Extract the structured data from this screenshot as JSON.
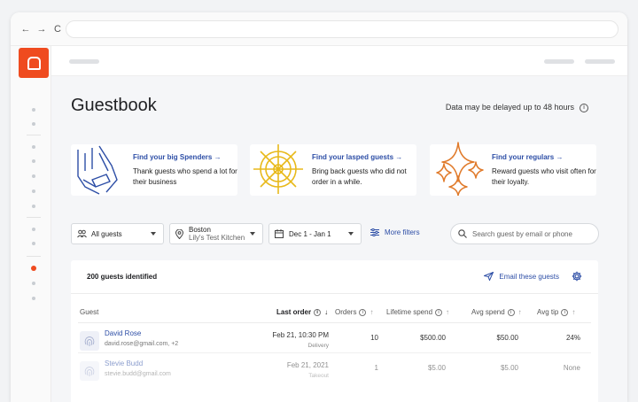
{
  "nav": {
    "back": "←",
    "forward": "→",
    "reload": "C"
  },
  "page": {
    "title": "Guestbook",
    "delay_note": "Data may be delayed up to 48 hours"
  },
  "cards": [
    {
      "title": "Find your big Spenders →",
      "desc": "Thank guests who spend a lot for their business"
    },
    {
      "title": "Find your lasped guests →",
      "desc": "Bring back guests who did not order in a while."
    },
    {
      "title": "Find your regulars →",
      "desc": "Reward guests who visit often for their loyalty."
    }
  ],
  "filters": {
    "guests": "All guests",
    "location_city": "Boston",
    "location_name": "Lily's Test Kitchen",
    "date_range": "Dec 1 - Jan 1",
    "more_filters": "More filters",
    "search_placeholder": "Search guest by email or phone"
  },
  "summary": {
    "count": "200 guests identified",
    "email_action": "Email these guests"
  },
  "table": {
    "headers": {
      "guest": "Guest",
      "last_order": "Last order",
      "orders": "Orders",
      "lifetime_spend": "Lifetime spend",
      "avg_spend": "Avg spend",
      "avg_tip": "Avg tip"
    },
    "rows": [
      {
        "name": "David Rose",
        "email": "david.rose@gmail.com, +2",
        "last_order": "Feb 21, 10:30 PM",
        "order_type": "Delivery",
        "orders": "10",
        "lifetime_spend": "$500.00",
        "avg_spend": "$50.00",
        "avg_tip": "24%"
      },
      {
        "name": "Stevie Budd",
        "email": "stevie.budd@gmail.com",
        "last_order": "Feb 21, 2021",
        "order_type": "Takeout",
        "orders": "1",
        "lifetime_spend": "$5.00",
        "avg_spend": "$5.00",
        "avg_tip": "None"
      }
    ]
  },
  "colors": {
    "brand": "#ef4b1f",
    "link": "#2d4ea6",
    "card_blue": "#2d4ea6",
    "card_gold": "#e8b91a",
    "card_orange": "#e07a2a"
  }
}
